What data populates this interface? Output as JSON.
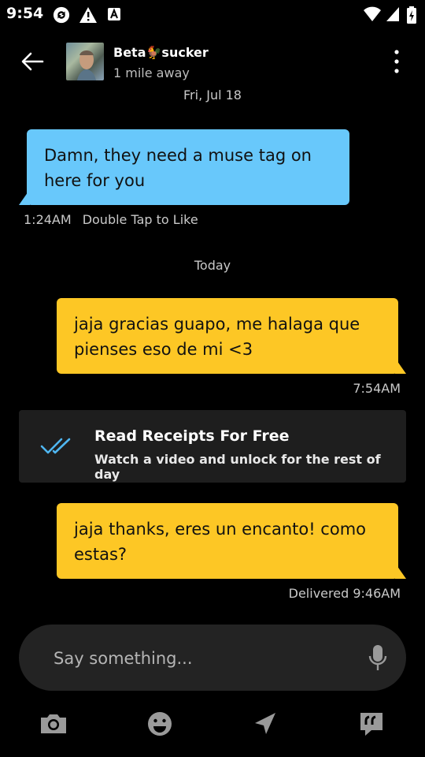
{
  "status_bar": {
    "time": "9:54"
  },
  "header": {
    "contact_name": "Beta🐓sucker",
    "distance": "1 mile away"
  },
  "messages": {
    "date_prev": "Fri, Jul 18",
    "incoming_1": {
      "text": "Damn, they need a muse tag on here for you",
      "time": "1:24AM",
      "hint": "Double Tap to Like"
    },
    "date_today": "Today",
    "outgoing_1": {
      "text": "jaja gracias guapo, me halaga que pienses eso de mi <3",
      "time": "7:54AM"
    },
    "outgoing_2": {
      "text": "jaja thanks, eres un encanto! como estas?",
      "status": "Delivered 9:46AM"
    }
  },
  "read_receipts": {
    "title": "Read Receipts For Free",
    "subtitle": "Watch a video and unlock for the rest of day"
  },
  "composer": {
    "placeholder": "Say something..."
  },
  "toolbar": {
    "icons": [
      "camera-icon",
      "emoji-icon",
      "location-icon",
      "saved-phrases-icon"
    ]
  },
  "colors": {
    "incoming_bubble": "#68c8fb",
    "outgoing_bubble": "#fdc725",
    "background": "#000000",
    "receipts_card": "#1e1e1e",
    "receipts_check": "#4fb6f0"
  }
}
